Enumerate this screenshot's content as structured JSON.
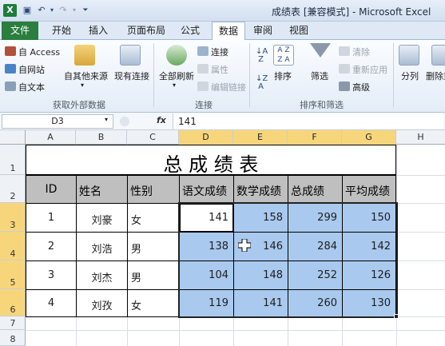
{
  "window": {
    "title": "成绩表 [兼容模式] - Microsoft Excel",
    "app_icon_letter": "X"
  },
  "quick_access": {
    "save_icon": "save-icon",
    "undo_icon": "undo-icon",
    "redo_icon": "redo-icon",
    "customize_icon": "customize-icon"
  },
  "ribbon_tabs": [
    {
      "label": "文件"
    },
    {
      "label": "开始"
    },
    {
      "label": "插入"
    },
    {
      "label": "页面布局"
    },
    {
      "label": "公式"
    },
    {
      "label": "数据"
    },
    {
      "label": "审阅"
    },
    {
      "label": "视图"
    }
  ],
  "active_tab": "数据",
  "ribbon": {
    "external_data": {
      "from_access": "自 Access",
      "from_web": "自网站",
      "from_text": "自文本",
      "from_other": "自其他来源",
      "existing": "现有连接",
      "group_label": "获取外部数据"
    },
    "connections": {
      "refresh_all": "全部刷新",
      "connections": "连接",
      "properties": "属性",
      "edit_links": "编辑链接",
      "group_label": "连接"
    },
    "sort_filter": {
      "sort": "排序",
      "filter": "筛选",
      "clear": "清除",
      "reapply": "重新应用",
      "advanced": "高级",
      "group_label": "排序和筛选"
    },
    "data_tools": {
      "split": "分列",
      "remove_dup": "删除重复项"
    }
  },
  "formula_bar": {
    "name_box": "D3",
    "fx": "fx",
    "value": "141"
  },
  "columns": [
    "A",
    "B",
    "C",
    "D",
    "E",
    "F",
    "G",
    "H"
  ],
  "selected_columns": [
    "D",
    "E",
    "F",
    "G"
  ],
  "rows": [
    "1",
    "2",
    "3",
    "4",
    "5",
    "6",
    "7",
    "8"
  ],
  "selected_rows": [
    "3",
    "4",
    "5",
    "6"
  ],
  "sheet": {
    "title": "总 成 绩 表",
    "headers": [
      "ID",
      "姓名",
      "性别",
      "语文成绩",
      "数学成绩",
      "总成绩",
      "平均成绩"
    ],
    "records": [
      {
        "id": "1",
        "name": "刘豪",
        "gender": "女",
        "chinese": "141",
        "math": "158",
        "total": "299",
        "avg": "150"
      },
      {
        "id": "2",
        "name": "刘浩",
        "gender": "男",
        "chinese": "138",
        "math": "146",
        "total": "284",
        "avg": "142"
      },
      {
        "id": "3",
        "name": "刘杰",
        "gender": "男",
        "chinese": "104",
        "math": "148",
        "total": "252",
        "avg": "126"
      },
      {
        "id": "4",
        "name": "刘孜",
        "gender": "女",
        "chinese": "119",
        "math": "141",
        "total": "260",
        "avg": "130"
      }
    ]
  },
  "colors": {
    "selection": "#a9c9ee",
    "header_fill": "#bfbfbf",
    "file_tab": "#2a7e3e",
    "highlight_header": "#f7d67b"
  }
}
